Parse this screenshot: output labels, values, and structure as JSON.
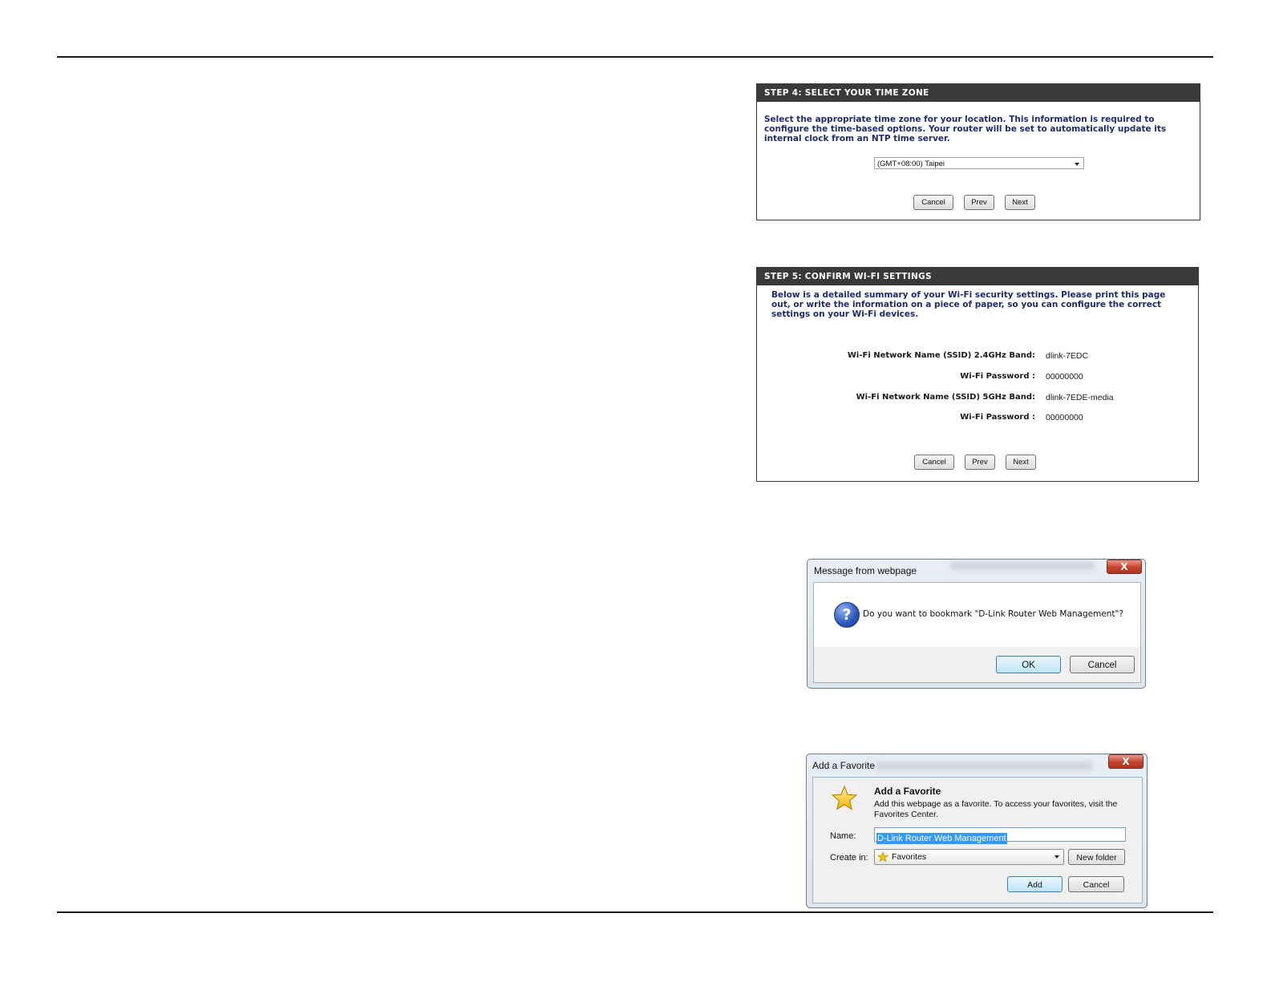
{
  "step4": {
    "header": "STEP 4: SELECT YOUR TIME ZONE",
    "description": "Select the appropriate time zone for your location. This information is required to configure the time-based options. Your router will be set to automatically update its internal clock from an NTP time server.",
    "timezone_value": "(GMT+08:00) Taipei",
    "buttons": {
      "cancel": "Cancel",
      "prev": "Prev",
      "next": "Next"
    }
  },
  "step5": {
    "header": "STEP 5: CONFIRM WI-FI SETTINGS",
    "description": "Below is a detailed summary of your Wi-Fi security settings. Please print this page out, or write the information on a piece of paper, so you can configure the correct settings on your Wi-Fi devices.",
    "settings": [
      {
        "label": "Wi-Fi Network Name (SSID)  2.4GHz Band:",
        "value": "dlink-7EDC"
      },
      {
        "label": "Wi-Fi Password :",
        "value": "00000000"
      },
      {
        "label": "Wi-Fi Network Name (SSID)  5GHz Band:",
        "value": "dlink-7EDE-media"
      },
      {
        "label": "Wi-Fi Password :",
        "value": "00000000"
      }
    ],
    "buttons": {
      "cancel": "Cancel",
      "prev": "Prev",
      "next": "Next"
    }
  },
  "message_dialog": {
    "title": "Message from webpage",
    "close": "X",
    "icon": "question-icon",
    "message": "Do you want to bookmark \"D-Link Router Web Management\"?",
    "ok": "OK",
    "cancel": "Cancel"
  },
  "favorite_dialog": {
    "title": "Add a Favorite",
    "close": "X",
    "icon": "star-icon",
    "heading": "Add a Favorite",
    "description": "Add this webpage as a favorite. To access your favorites, visit the Favorites Center.",
    "name_label": "Name:",
    "name_value": "D-Link Router Web Management",
    "create_in_label": "Create in:",
    "create_in_value": "Favorites",
    "new_folder": "New folder",
    "add": "Add",
    "cancel": "Cancel"
  },
  "colors": {
    "panel_header": "#3a3a3a",
    "description_text": "#1f2b6d",
    "close_button": "#c4422c",
    "selection": "#3399ff"
  }
}
